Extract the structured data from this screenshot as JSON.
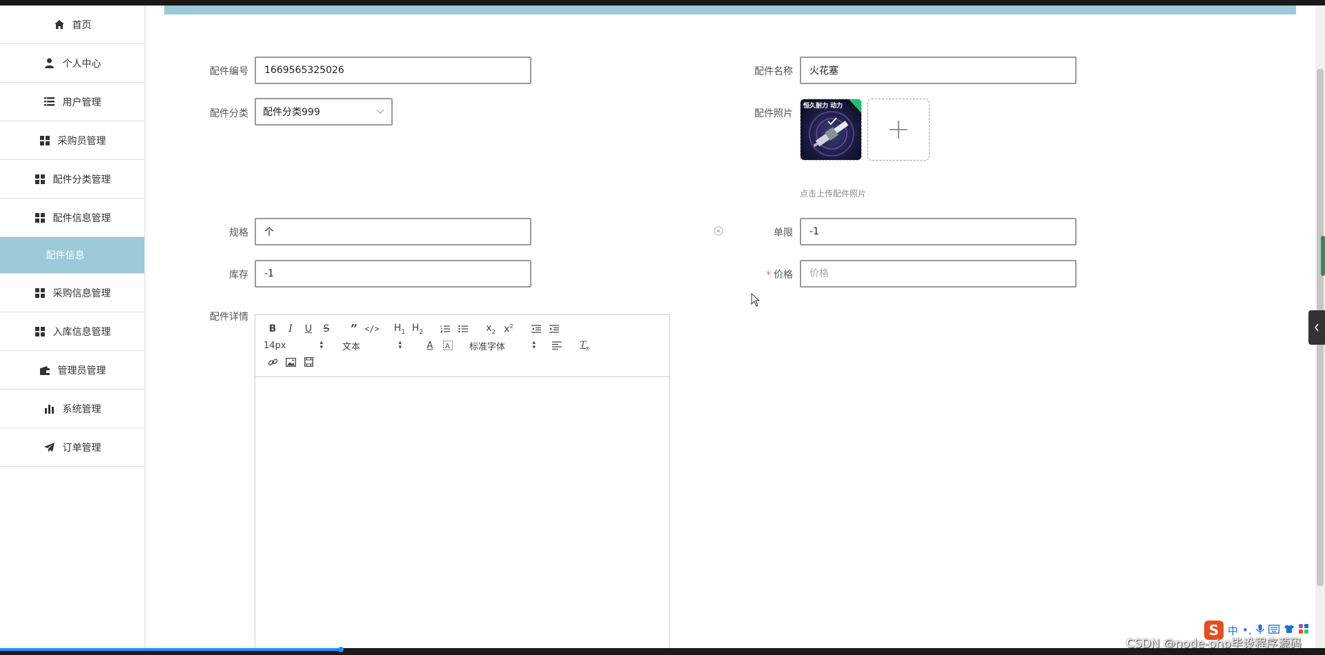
{
  "sidebar": {
    "items": [
      {
        "label": "首页",
        "icon": "home-icon"
      },
      {
        "label": "个人中心",
        "icon": "user-icon"
      },
      {
        "label": "用户管理",
        "icon": "list-icon"
      },
      {
        "label": "采购员管理",
        "icon": "grid-icon"
      },
      {
        "label": "配件分类管理",
        "icon": "grid-icon"
      },
      {
        "label": "配件信息管理",
        "icon": "grid-icon"
      },
      {
        "label": "配件信息",
        "icon": "",
        "active": true
      },
      {
        "label": "采购信息管理",
        "icon": "grid-icon"
      },
      {
        "label": "入库信息管理",
        "icon": "grid-icon"
      },
      {
        "label": "管理员管理",
        "icon": "wallet-icon"
      },
      {
        "label": "系统管理",
        "icon": "bar-chart-icon"
      },
      {
        "label": "订单管理",
        "icon": "paper-plane-icon"
      }
    ]
  },
  "form": {
    "part_no": {
      "label": "配件编号",
      "value": "1669565325026"
    },
    "part_name": {
      "label": "配件名称",
      "value": "火花塞"
    },
    "category": {
      "label": "配件分类",
      "value": "配件分类999"
    },
    "photo": {
      "label": "配件照片",
      "upload_tip": "点击上传配件照片",
      "thumb_text": "恒久耐力 动力"
    },
    "spec": {
      "label": "规格",
      "value": "个"
    },
    "limit": {
      "label": "单限",
      "value": "-1"
    },
    "stock": {
      "label": "库存",
      "value": "-1"
    },
    "price": {
      "label": "价格",
      "value": "",
      "placeholder": "价格",
      "required_mark": "*"
    },
    "detail": {
      "label": "配件详情"
    }
  },
  "editor": {
    "font_size": "14px",
    "header_select": "文本",
    "font_family": "标准字体"
  },
  "watermark": "CSDN @node-php毕设程序源码",
  "ime": {
    "brand": "S",
    "lang": "中"
  },
  "colors": {
    "accent": "#9ccad8",
    "required": "#f56c6c",
    "progress": "#1e90ff"
  }
}
